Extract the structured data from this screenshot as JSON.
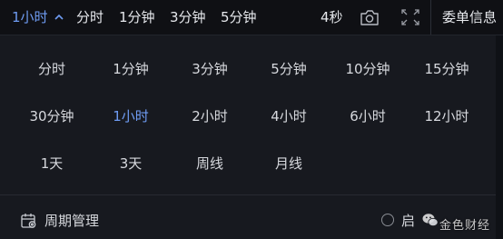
{
  "toolbar": {
    "current_period": "1小时",
    "quick_periods": [
      "分时",
      "1分钟",
      "3分钟",
      "5分钟"
    ],
    "countdown": "4秒",
    "order_info_label": "委单信息"
  },
  "period_panel": {
    "rows": [
      [
        "分时",
        "1分钟",
        "3分钟",
        "5分钟",
        "10分钟",
        "15分钟"
      ],
      [
        "30分钟",
        "1小时",
        "2小时",
        "4小时",
        "6小时",
        "12小时"
      ],
      [
        "1天",
        "3天",
        "周线",
        "月线"
      ]
    ],
    "selected": "1小时",
    "manage_label": "周期管理",
    "option_label": "启"
  },
  "watermark": {
    "text": "金色财经"
  },
  "icons": {
    "caret": "chevron-up-icon",
    "screenshot": "camera-icon",
    "fullscreen": "expand-icon",
    "manage": "calendar-settings-icon",
    "watermark": "wechat-icon"
  },
  "colors": {
    "accent": "#6f9cf3",
    "text": "#d7d9de",
    "background": "#17191f",
    "topbar": "#0f1014"
  }
}
